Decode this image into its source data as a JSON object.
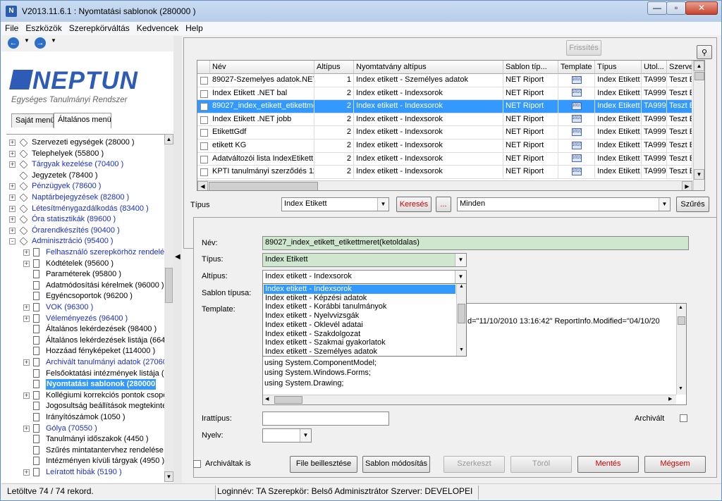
{
  "window": {
    "title": "V2013.11.6.1 : Nyomtatási sablonok (280000 )",
    "app_icon_letter": "N",
    "minimize": "—",
    "maximize": "▫",
    "close": "✕"
  },
  "menu": [
    "File",
    "Eszközök",
    "Szerepkörváltás",
    "Kedvencek",
    "Help"
  ],
  "logo": {
    "word": "NEPTUN",
    "subtitle": "Egységes Tanulmányi Rendszer"
  },
  "left_tabs": [
    "Saját menü",
    "Általános menü"
  ],
  "tree": [
    {
      "label": "Szervezeti egységek (28000 )",
      "level": 0,
      "expander": "+",
      "icon": "diamond",
      "blue": false
    },
    {
      "label": "Telephelyek (55800 )",
      "level": 0,
      "expander": "+",
      "icon": "diamond",
      "blue": false
    },
    {
      "label": "Tárgyak kezelése (70400 )",
      "level": 0,
      "expander": "+",
      "icon": "diamond",
      "blue": true
    },
    {
      "label": "Jegyzetek (78400 )",
      "level": 0,
      "expander": "",
      "icon": "diamond",
      "blue": false
    },
    {
      "label": "Pénzügyek (78600 )",
      "level": 0,
      "expander": "+",
      "icon": "diamond",
      "blue": true
    },
    {
      "label": "Naptárbejegyzések (82800 )",
      "level": 0,
      "expander": "+",
      "icon": "diamond",
      "blue": true
    },
    {
      "label": "Létesítménygazdálkodás (83400 )",
      "level": 0,
      "expander": "+",
      "icon": "diamond",
      "blue": true
    },
    {
      "label": "Óra statisztikák (89600 )",
      "level": 0,
      "expander": "+",
      "icon": "diamond",
      "blue": true
    },
    {
      "label": "Órarendkészítés (90400 )",
      "level": 0,
      "expander": "+",
      "icon": "diamond",
      "blue": true
    },
    {
      "label": "Adminisztráció (95400 )",
      "level": 0,
      "expander": "−",
      "icon": "diamond",
      "blue": true
    },
    {
      "label": "Felhasználó szerepkörhöz rendelése",
      "level": 1,
      "expander": "+",
      "icon": "doc",
      "blue": true
    },
    {
      "label": "Kódtételek (95600 )",
      "level": 1,
      "expander": "+",
      "icon": "doc",
      "blue": false
    },
    {
      "label": "Paraméterek (95800 )",
      "level": 1,
      "expander": "",
      "icon": "doc",
      "blue": false
    },
    {
      "label": "Adatmódosítási kérelmek (96000 )",
      "level": 1,
      "expander": "",
      "icon": "doc",
      "blue": false
    },
    {
      "label": "Egyéncsoportok (96200 )",
      "level": 1,
      "expander": "",
      "icon": "doc",
      "blue": false
    },
    {
      "label": "VOK (96300 )",
      "level": 1,
      "expander": "+",
      "icon": "doc",
      "blue": true
    },
    {
      "label": "Véleményezés (96400 )",
      "level": 1,
      "expander": "+",
      "icon": "doc",
      "blue": true
    },
    {
      "label": "Általános lekérdezések (98400 )",
      "level": 1,
      "expander": "",
      "icon": "doc",
      "blue": false
    },
    {
      "label": "Általános lekérdezések listája (664",
      "level": 1,
      "expander": "",
      "icon": "doc",
      "blue": false
    },
    {
      "label": "Hozzáad fényképeket (114000 )",
      "level": 1,
      "expander": "",
      "icon": "doc",
      "blue": false
    },
    {
      "label": "Archivált tanulmányi adatok (27060",
      "level": 1,
      "expander": "+",
      "icon": "doc",
      "blue": true
    },
    {
      "label": "Felsőoktatási intézmények listája (2",
      "level": 1,
      "expander": "",
      "icon": "doc",
      "blue": false
    },
    {
      "label": "Nyomtatási sablonok (280000",
      "level": 1,
      "expander": "",
      "icon": "doc",
      "blue": false,
      "selected": true
    },
    {
      "label": "Kollégiumi korrekciós pontok csopo",
      "level": 1,
      "expander": "+",
      "icon": "doc",
      "blue": false
    },
    {
      "label": "Jogosultság beállítások megtekinté",
      "level": 1,
      "expander": "",
      "icon": "doc",
      "blue": false
    },
    {
      "label": "Irányítószámok (1050 )",
      "level": 1,
      "expander": "",
      "icon": "doc",
      "blue": false
    },
    {
      "label": "Gólya (70550 )",
      "level": 1,
      "expander": "+",
      "icon": "doc",
      "blue": true
    },
    {
      "label": "Tanulmányi időszakok (4450 )",
      "level": 1,
      "expander": "",
      "icon": "doc",
      "blue": false
    },
    {
      "label": "Szűrés mintatantervhez rendelése (",
      "level": 1,
      "expander": "",
      "icon": "doc",
      "blue": false
    },
    {
      "label": "Intézményen kívüli tárgyak (4950 )",
      "level": 1,
      "expander": "",
      "icon": "doc",
      "blue": false
    },
    {
      "label": "Leíratott hibák (5190 )",
      "level": 1,
      "expander": "+",
      "icon": "doc",
      "blue": true
    }
  ],
  "toolbar": {
    "refresh": "Frissítés"
  },
  "grid": {
    "columns": [
      "Név",
      "Altípus",
      "Nyomtatvány altípus",
      "Sablon típ...",
      "Template",
      "Típus",
      "Utol...",
      "Szervez"
    ],
    "rows": [
      {
        "nev": "89027-Szemelyes adatok.NET",
        "altipus": "1",
        "nyomt": "Index etikett - Személyes adatok",
        "sablon": "NET Riport",
        "tipus": "Index Etikett",
        "utol": "TA999",
        "szerv": "Teszt Eg"
      },
      {
        "nev": "Index Etikett .NET bal",
        "altipus": "2",
        "nyomt": "Index etikett - Indexsorok",
        "sablon": "NET Riport",
        "tipus": "Index Etikett",
        "utol": "TA999",
        "szerv": "Teszt Eg"
      },
      {
        "nev": "89027_index_etikett_etikettme",
        "altipus": "2",
        "nyomt": "Index etikett - Indexsorok",
        "sablon": "NET Riport",
        "tipus": "Index Etikett",
        "utol": "TA999",
        "szerv": "Teszt Eg",
        "selected": true
      },
      {
        "nev": "Index Etikett .NET jobb",
        "altipus": "2",
        "nyomt": "Index etikett - Indexsorok",
        "sablon": "NET Riport",
        "tipus": "Index Etikett",
        "utol": "TA999",
        "szerv": "Teszt Eg"
      },
      {
        "nev": "EtikettGdf",
        "altipus": "2",
        "nyomt": "Index etikett - Indexsorok",
        "sablon": "NET Riport",
        "tipus": "Index Etikett",
        "utol": "TA999",
        "szerv": "Teszt Eg"
      },
      {
        "nev": "etikett KG",
        "altipus": "2",
        "nyomt": "Index etikett - Indexsorok",
        "sablon": "NET Riport",
        "tipus": "Index Etikett",
        "utol": "TA999",
        "szerv": "Teszt Eg"
      },
      {
        "nev": "Adatváltozói lista IndexEtikett",
        "altipus": "2",
        "nyomt": "Index etikett - Indexsorok",
        "sablon": "NET Riport",
        "tipus": "Index Etikett",
        "utol": "TA999",
        "szerv": "Teszt Eg"
      },
      {
        "nev": "KPTI tanulmányi szerződés 11",
        "altipus": "2",
        "nyomt": "Index etikett - Indexsorok",
        "sablon": "NET Riport",
        "tipus": "Index Etikett",
        "utol": "TA999",
        "szerv": "Teszt Eg"
      }
    ],
    "template_icon_text": "1010"
  },
  "filter": {
    "label": "Típus",
    "type_value": "Index Etikett",
    "search": "Keresés",
    "ellipsis": "...",
    "scope_value": "Minden",
    "filter_button": "Szűrés"
  },
  "detail": {
    "nev_label": "Név:",
    "nev_value": "89027_index_etikett_etikettmeret(ketoldalas)",
    "tipus_label": "Típus:",
    "tipus_value": "Index Etikett",
    "altipus_label": "Altípus:",
    "altipus_value": "Index etikett - Indexsorok",
    "sablon_label": "Sablon típusa:",
    "template_label": "Template:",
    "template_lines": [
      "d=\"11/10/2010 13:16:42\" ReportInfo.Modified=\"04/10/20",
      "using System.ComponentModel;",
      "using System.Windows.Forms;",
      "using System.Drawing;"
    ],
    "irattipus_label": "Irattípus:",
    "nyelv_label": "Nyelv:",
    "archivalt_label": "Archivált",
    "dropdown_options": [
      "Index etikett - Indexsorok",
      "Index etikett - Képzési adatok",
      "Index etikett - Korábbi tanulmányok",
      "Index etikett - Nyelvvizsgák",
      "Index etikett - Oklevél adatai",
      "Index etikett - Szakdolgozat",
      "Index etikett - Szakmai gyakorlatok",
      "Index etikett - Személyes adatok"
    ]
  },
  "actions": {
    "archived_checkbox": "Archiváltak is",
    "file_load": "File beillesztése",
    "sablon_mod": "Sablon módosítás",
    "szerkeszt": "Szerkeszt",
    "torol": "Töröl",
    "mentes": "Mentés",
    "megsem": "Mégsem"
  },
  "status": {
    "records": "Letöltve 74 / 74 rekord.",
    "login": "Loginnév: TA  Szerepkör: Belső Adminisztrátor  Szerver: DEVELOPEI"
  },
  "colors": {
    "selection": "#3399ff",
    "link_blue": "#1a2fc8",
    "name_field_bg": "#cfe6cf",
    "red_button_text": "#cc0000",
    "logo_blue": "#2d5bb5"
  }
}
